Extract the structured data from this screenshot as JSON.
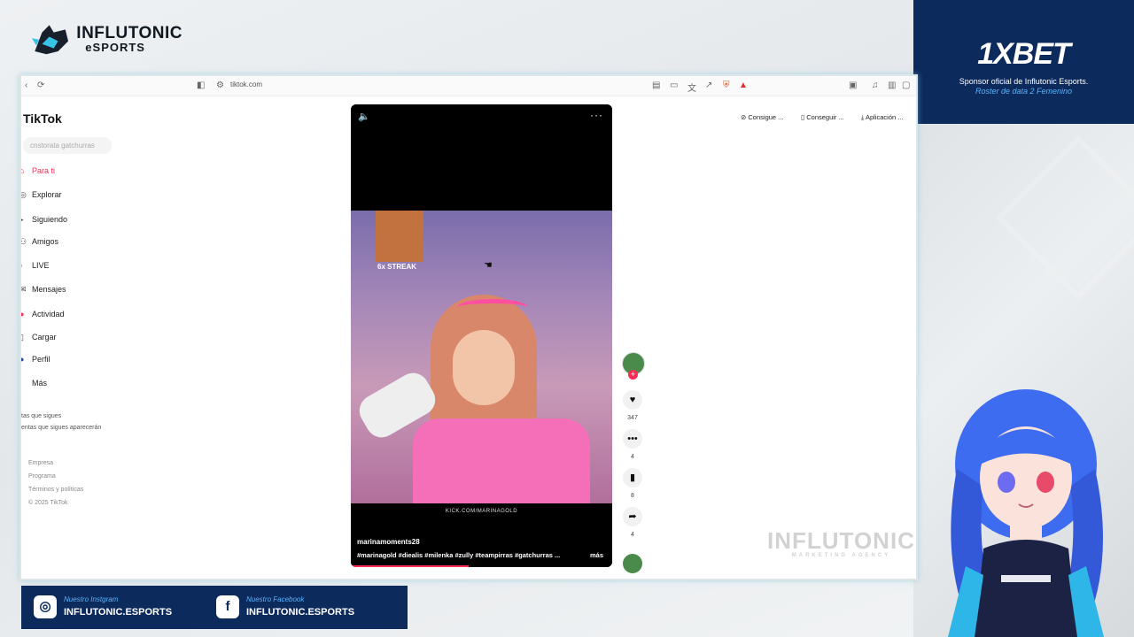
{
  "overlay": {
    "brand_line1": "INFLUTONIC",
    "brand_line2": "eSPORTS"
  },
  "sponsor": {
    "brand": "1XBET",
    "line1": "Sponsor oficial de Influtonic Esports.",
    "line2": "Roster de data 2 Femenino"
  },
  "browser": {
    "url": "tiktok.com"
  },
  "tiktok": {
    "logo": "TikTok",
    "search_placeholder": "cnstorata gatchurras",
    "nav": [
      {
        "label": "Para ti",
        "icon": "home-icon",
        "active": true
      },
      {
        "label": "Explorar",
        "icon": "compass-icon",
        "active": false
      },
      {
        "label": "Siguiendo",
        "icon": "following-icon",
        "active": false
      },
      {
        "label": "Amigos",
        "icon": "friends-icon",
        "active": false
      },
      {
        "label": "LIVE",
        "icon": "live-icon",
        "active": false
      },
      {
        "label": "Mensajes",
        "icon": "messages-icon",
        "active": false
      },
      {
        "label": "Actividad",
        "icon": "activity-icon",
        "active": false
      },
      {
        "label": "Cargar",
        "icon": "upload-icon",
        "active": false
      },
      {
        "label": "Perfil",
        "icon": "profile-icon",
        "active": false
      },
      {
        "label": "Más",
        "icon": "more-icon",
        "active": false
      }
    ],
    "following_hint_title": "tas que sigues",
    "following_hint_body": "entas que sigues aparecerán",
    "footer": [
      "Empresa",
      "Programa",
      "Términos y políticas",
      "© 2025 TikTok"
    ],
    "header_pills": [
      "Consigue ...",
      "Conseguir ...",
      "Aplicación ..."
    ]
  },
  "video": {
    "streak": "6x STREAK",
    "overlay_text": "KICK.COM/MARINAGOLD",
    "author": "marinamoments28",
    "tags": "#marinagold #diealis #milenka #zully #teampirras #gatchurras ...",
    "more": "más",
    "progress": 0.45,
    "likes": "347",
    "comments": "4",
    "saves": "8",
    "shares": "4"
  },
  "watermark": {
    "main": "INFLUTONIC",
    "sub": "MARKETING AGENCY"
  },
  "social": {
    "instagram_caption": "Nuestro Instgram",
    "instagram_handle": "INFLUTONIC.ESPORTS",
    "facebook_caption": "Nuestro Facebook",
    "facebook_handle": "INFLUTONIC.ESPORTS"
  },
  "colors": {
    "accent": "#fe2c55",
    "panel": "#0c2a5c",
    "panel_highlight": "#5ab4ff"
  }
}
